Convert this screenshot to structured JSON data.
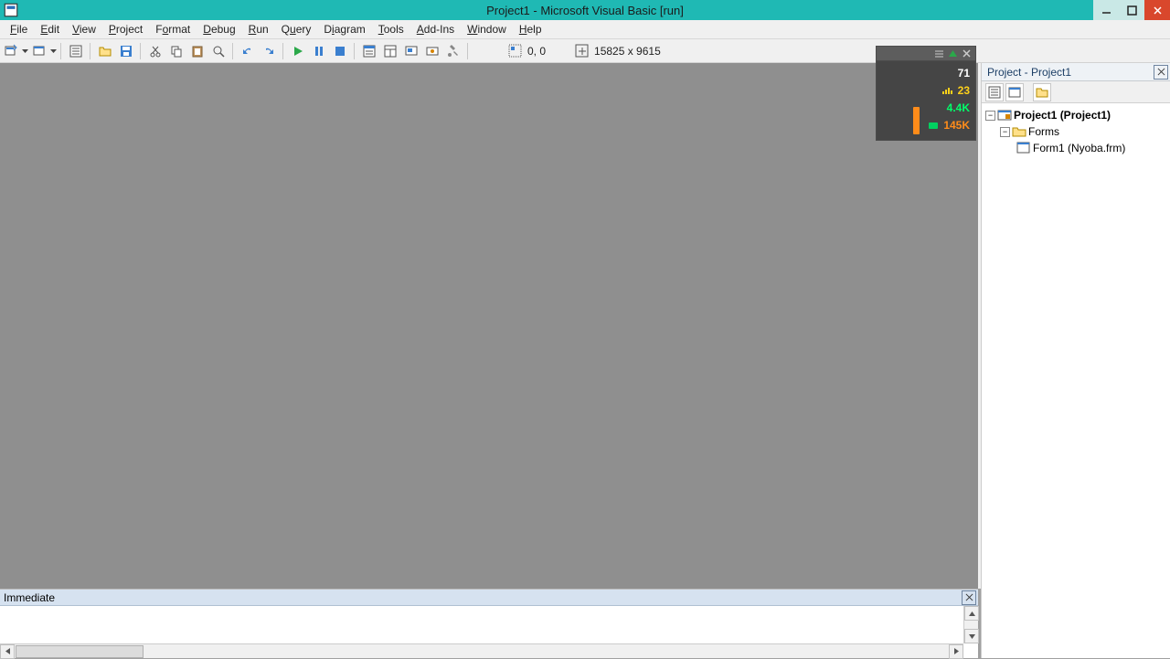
{
  "titlebar": {
    "title": "Project1 - Microsoft Visual Basic [run]"
  },
  "menu": {
    "file": "File",
    "edit": "Edit",
    "view": "View",
    "project": "Project",
    "format": "Format",
    "debug": "Debug",
    "run": "Run",
    "query": "Query",
    "diagram": "Diagram",
    "tools": "Tools",
    "addins": "Add-Ins",
    "window": "Window",
    "help": "Help"
  },
  "toolbar": {
    "pos": "0, 0",
    "size": "15825 x 9615"
  },
  "overlay": {
    "v1": "71",
    "v2": "23",
    "v3": "4.4K",
    "v4": "145K"
  },
  "project_panel": {
    "title": "Project - Project1",
    "root": "Project1 (Project1)",
    "forms_folder": "Forms",
    "form1": "Form1 (Nyoba.frm)"
  },
  "immediate": {
    "title": "Immediate"
  }
}
